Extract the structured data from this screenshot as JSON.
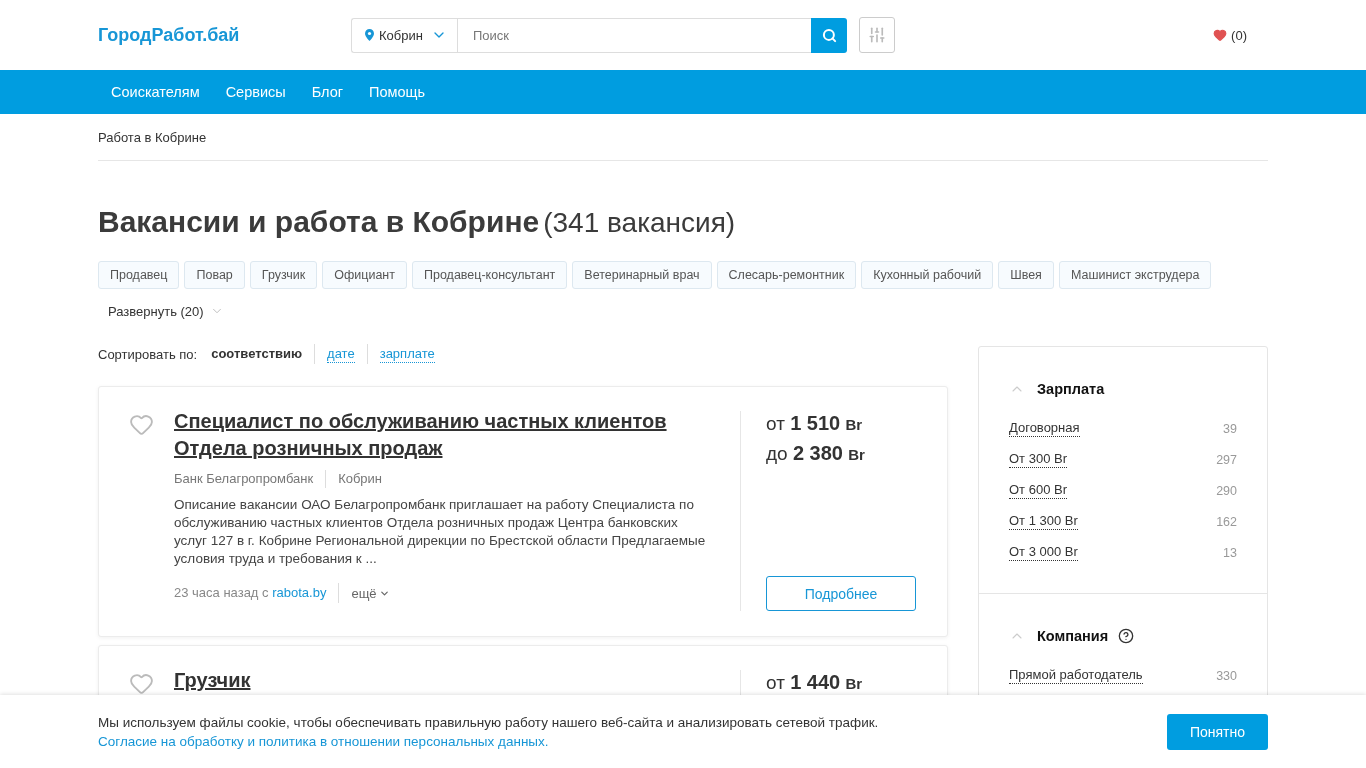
{
  "header": {
    "logo": "ГородРабот.бай",
    "city": "Кобрин",
    "search": {
      "placeholder": "Поиск"
    },
    "favorites": "(0)"
  },
  "nav": [
    "Соискателям",
    "Сервисы",
    "Блог",
    "Помощь"
  ],
  "breadcrumb": "Работа в Кобрине",
  "heading": {
    "title": "Вакансии и работа в Кобрине",
    "count": "(341 вакансия)"
  },
  "tags": [
    "Продавец",
    "Повар",
    "Грузчик",
    "Официант",
    "Продавец-консультант",
    "Ветеринарный врач",
    "Слесарь-ремонтник",
    "Кухонный рабочий",
    "Швея",
    "Машинист экструдера"
  ],
  "expand": "Развернуть (20)",
  "sort": {
    "label": "Сортировать по:",
    "options": [
      {
        "label": "соответствию",
        "selected": true
      },
      {
        "label": "дате",
        "selected": false
      },
      {
        "label": "зарплате",
        "selected": false
      }
    ]
  },
  "vacancies": [
    {
      "title": "Специалист по обслуживанию частных клиентов Отдела розничных продаж",
      "saved": false,
      "company": "Банк Белагропромбанк",
      "city": "Кобрин",
      "description": "Описание вакансии ОАО Белагропромбанк приглашает на работу Специалиста по обслуживанию частных клиентов Отдела розничных продаж Центра банковских услуг 127 в г. Кобрине Региональной дирекции по Брестской области Предлагаемые условия труда и требования к ...",
      "posted": "23 часа назад с",
      "source": "rabota.by",
      "more": "ещё",
      "salary": [
        {
          "prefix": "от",
          "amount": "1 510",
          "currency": "Br"
        },
        {
          "prefix": "до",
          "amount": "2 380",
          "currency": "Br"
        }
      ],
      "button": "Подробнее"
    },
    {
      "title": "Грузчик",
      "saved": false,
      "salary": [
        {
          "prefix": "от",
          "amount": "1 440",
          "currency": "Br"
        }
      ]
    }
  ],
  "filters": [
    {
      "title": "Зарплата",
      "expanded": true,
      "help": false,
      "options": [
        {
          "label": "Договорная",
          "count": "39"
        },
        {
          "label": "От 300 Br",
          "count": "297"
        },
        {
          "label": "От 600 Br",
          "count": "290"
        },
        {
          "label": "От 1 300 Br",
          "count": "162"
        },
        {
          "label": "От 3 000 Br",
          "count": "13"
        }
      ]
    },
    {
      "title": "Компания",
      "expanded": true,
      "help": true,
      "options": [
        {
          "label": "Прямой работодатель",
          "count": "330"
        }
      ]
    }
  ],
  "cookie_banner": {
    "text": "Мы используем файлы cookie, чтобы обеспечивать правильную работу нашего веб-сайта и анализировать сетевой трафик.",
    "link": "Согласие на обработку и политика в отношении персональных данных.",
    "button": "Понятно"
  }
}
